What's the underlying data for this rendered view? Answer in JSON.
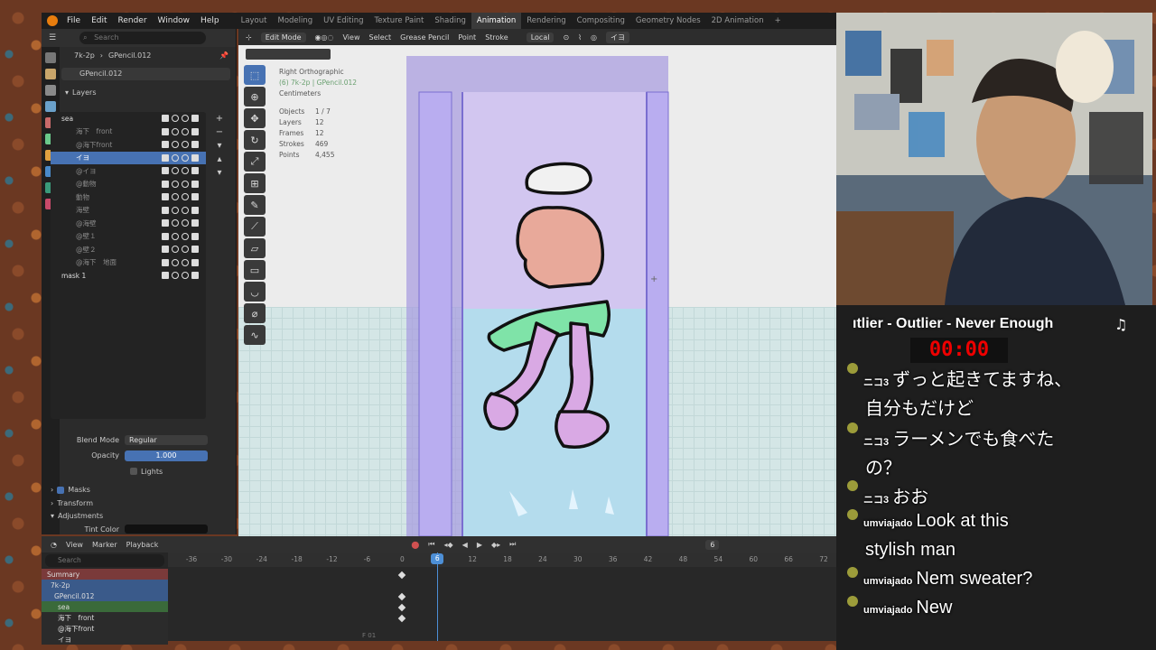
{
  "menu": {
    "items": [
      "File",
      "Edit",
      "Render",
      "Window",
      "Help"
    ],
    "workspaces": [
      "Layout",
      "Modeling",
      "UV Editing",
      "Texture Paint",
      "Shading",
      "Animation",
      "Rendering",
      "Compositing",
      "Geometry Nodes",
      "2D Animation",
      "+"
    ],
    "active_workspace": "Animation"
  },
  "properties": {
    "search_placeholder": "Search",
    "breadcrumb_object": "7k-2p",
    "breadcrumb_data": "GPencil.012",
    "datablock": "GPencil.012",
    "layers_title": "Layers",
    "layers": [
      {
        "name": "sea",
        "indent": 0,
        "group": true
      },
      {
        "name": "海下　front",
        "indent": 1
      },
      {
        "name": "@海下front",
        "indent": 1
      },
      {
        "name": "イヨ",
        "indent": 1,
        "active": true
      },
      {
        "name": "@イヨ",
        "indent": 1
      },
      {
        "name": "@動物",
        "indent": 1
      },
      {
        "name": "動物",
        "indent": 1
      },
      {
        "name": "海壁",
        "indent": 1
      },
      {
        "name": "@海壁",
        "indent": 1
      },
      {
        "name": "@壁１",
        "indent": 1
      },
      {
        "name": "@壁２",
        "indent": 1
      },
      {
        "name": "@海下　地面",
        "indent": 1
      },
      {
        "name": "mask 1",
        "indent": 0,
        "group": true
      }
    ],
    "blend_mode_label": "Blend Mode",
    "blend_mode_value": "Regular",
    "opacity_label": "Opacity",
    "opacity_value": "1.000",
    "lights_label": "Lights",
    "masks_label": "Masks",
    "transform_label": "Transform",
    "adjustments_label": "Adjustments",
    "tint_label": "Tint Color"
  },
  "viewport": {
    "mode": "Edit Mode",
    "menus": [
      "View",
      "Select",
      "Grease Pencil",
      "Point",
      "Stroke"
    ],
    "orientation": "Local",
    "layer_select": "イヨ",
    "view_name": "Right Orthographic",
    "view_sub": "(6) 7k-2p | GPencil.012",
    "units": "Centimeters",
    "stats": [
      {
        "label": "Objects",
        "value": "1 / 7"
      },
      {
        "label": "Layers",
        "value": "12"
      },
      {
        "label": "Frames",
        "value": "12"
      },
      {
        "label": "Strokes",
        "value": "469"
      },
      {
        "label": "Points",
        "value": "4,455"
      }
    ]
  },
  "timeline": {
    "menus": [
      "View",
      "Marker",
      "Playback"
    ],
    "frame": "6",
    "search_placeholder": "Search",
    "ticks": [
      "-36",
      "-30",
      "-24",
      "-18",
      "-12",
      "-6",
      "0",
      "6",
      "12",
      "18",
      "24",
      "30",
      "36",
      "42",
      "48",
      "54",
      "60",
      "66",
      "72"
    ],
    "current_frame": "6",
    "channels": [
      {
        "name": "Summary",
        "color": "#7a3a3a"
      },
      {
        "name": "7k-2p",
        "color": "#3a5a8a"
      },
      {
        "name": "GPencil.012",
        "color": "#3a5a8a"
      },
      {
        "name": "sea",
        "color": "#3a6a3a"
      },
      {
        "name": "海下　front",
        "color": "#2b2b2b"
      },
      {
        "name": "@海下front",
        "color": "#2b2b2b"
      },
      {
        "name": "イヨ",
        "color": "#2b2b2b"
      }
    ],
    "frame_label": "F 01"
  },
  "stream": {
    "song": "ıtlier - Outlier - Never Enough",
    "timer": "00:00",
    "chat": [
      {
        "user": "ニコ3",
        "msg": "ずっと起きてますね、"
      },
      {
        "user": "",
        "msg": "自分もだけど"
      },
      {
        "user": "ニコ3",
        "msg": "ラーメンでも食べた"
      },
      {
        "user": "",
        "msg": "の？"
      },
      {
        "user": "ニコ3",
        "msg": "おお"
      },
      {
        "user": "umviajado",
        "msg": "Look at this"
      },
      {
        "user": "",
        "msg": "stylish man"
      },
      {
        "user": "umviajado",
        "msg": "Nem sweater?"
      },
      {
        "user": "umviajado",
        "msg": "New"
      }
    ]
  }
}
